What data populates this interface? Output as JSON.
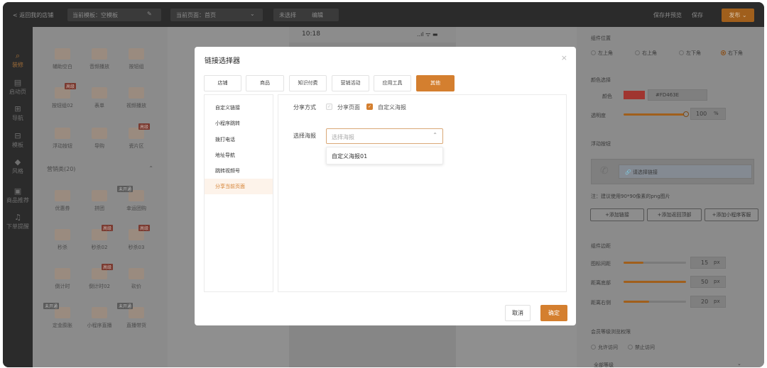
{
  "topbar": {
    "back": "< 返回我的店铺",
    "template": "当前模板：空模板",
    "page": "当前页面：首页",
    "unselected": "未选择",
    "edit": "编辑",
    "save_preview": "保存并预览",
    "save": "保存",
    "publish": "发布"
  },
  "sidenav": [
    {
      "label": "装修",
      "icon": "brush-icon"
    },
    {
      "label": "启动页",
      "icon": "launch-icon"
    },
    {
      "label": "导航",
      "icon": "grid-icon"
    },
    {
      "label": "模板",
      "icon": "template-icon"
    },
    {
      "label": "风格",
      "icon": "style-icon"
    },
    {
      "label": "商品推荐",
      "icon": "goods-icon"
    },
    {
      "label": "下单提醒",
      "icon": "bell-icon"
    }
  ],
  "library": {
    "items_top": [
      {
        "label": "辅助空白"
      },
      {
        "label": "音频播放"
      },
      {
        "label": "按钮组"
      },
      {
        "label": "按钮组02",
        "tag": "高级"
      },
      {
        "label": "表单"
      },
      {
        "label": "视频播放"
      },
      {
        "label": "浮动按钮"
      },
      {
        "label": "导购"
      },
      {
        "label": "瓷片区",
        "tag": "高级"
      }
    ],
    "section_title": "营销类(20)",
    "items_marketing": [
      {
        "label": "优惠券"
      },
      {
        "label": "拼团"
      },
      {
        "label": "幸运团购",
        "tag": "未开通"
      },
      {
        "label": "秒杀"
      },
      {
        "label": "秒杀02",
        "tag": "高级"
      },
      {
        "label": "秒杀03",
        "tag": "高级"
      },
      {
        "label": "倒计时"
      },
      {
        "label": "倒计时02",
        "tag": "高级"
      },
      {
        "label": "砍价"
      },
      {
        "label": "定金膨胀",
        "tag": "未开通"
      },
      {
        "label": "小程序直播"
      },
      {
        "label": "直播带货",
        "tag": "未开通"
      }
    ]
  },
  "phone": {
    "time": "10:18",
    "status": "..ıl ᯤ ▬"
  },
  "right_panel": {
    "position_title": "组件位置",
    "positions": [
      "左上角",
      "右上角",
      "左下角",
      "右下角"
    ],
    "color_title": "颜色选择",
    "color_label": "颜色",
    "color_value": "#FD463E",
    "opacity_label": "透明度",
    "opacity_value": "100",
    "percent": "%",
    "float_title": "浮动按钮",
    "link_placeholder": "请选择链接",
    "note": "注：建议使用90*90像素的png图片",
    "add_link": "+添加链接",
    "add_back_top": "+添加返回顶部",
    "add_service": "+添加小程序客服",
    "margin_title": "组件边距",
    "icon_gap": "图标间距",
    "icon_gap_value": "15",
    "bottom_dist": "距离底部",
    "bottom_value": "50",
    "right_dist": "距离右侧",
    "right_value": "20",
    "px": "px",
    "member_title": "会员等级浏览权限",
    "allow": "允许访问",
    "deny": "禁止访问",
    "all_levels": "全部等级",
    "accent_color": "#FD463E"
  },
  "modal": {
    "title": "链接选择器",
    "close": "×",
    "tabs": [
      "店铺",
      "商品",
      "知识付费",
      "营销活动",
      "应用工具",
      "其他"
    ],
    "active_tab": "其他",
    "left_items": [
      "自定义链接",
      "小程序跳转",
      "拨打电话",
      "地址导航",
      "跳转视频号",
      "分享当前页面"
    ],
    "share_label": "分享方式",
    "share_page": "分享页面",
    "custom_poster": "自定义海报",
    "poster_label": "选择海报",
    "poster_placeholder": "选择海报",
    "poster_option": "自定义海报01",
    "cancel": "取消",
    "ok": "确定",
    "accent": "#D47F2F"
  }
}
